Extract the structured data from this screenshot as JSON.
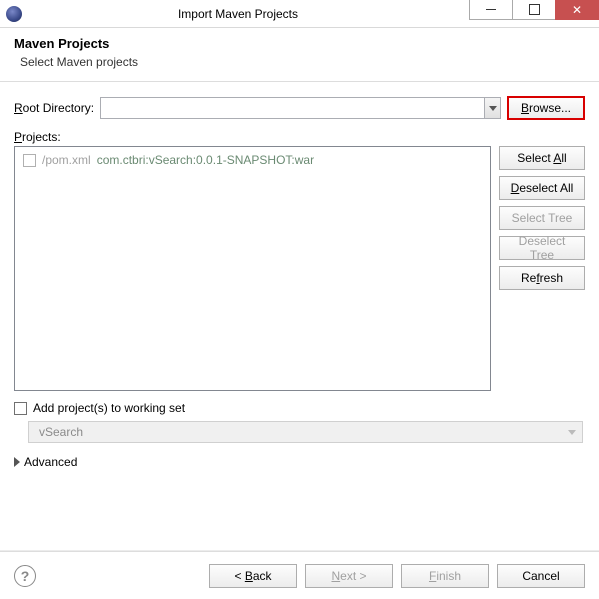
{
  "window": {
    "title": "Import Maven Projects"
  },
  "header": {
    "title": "Maven Projects",
    "subtitle": "Select Maven projects"
  },
  "rootDirectory": {
    "label": "Root Directory:",
    "value": "",
    "browse": "Browse..."
  },
  "projects": {
    "label": "Projects:",
    "items": [
      {
        "checked": false,
        "pom": "/pom.xml",
        "gav": "com.ctbri:vSearch:0.0.1-SNAPSHOT:war"
      }
    ],
    "buttons": {
      "selectAll": "Select All",
      "deselectAll": "Deselect All",
      "selectTree": "Select Tree",
      "deselectTree": "Deselect Tree",
      "refresh": "Refresh"
    }
  },
  "workingSet": {
    "checkboxLabel": "Add project(s) to working set",
    "checked": false,
    "selected": "vSearch"
  },
  "advanced": {
    "label": "Advanced"
  },
  "wizard": {
    "back": "< Back",
    "next": "Next >",
    "finish": "Finish",
    "cancel": "Cancel"
  }
}
